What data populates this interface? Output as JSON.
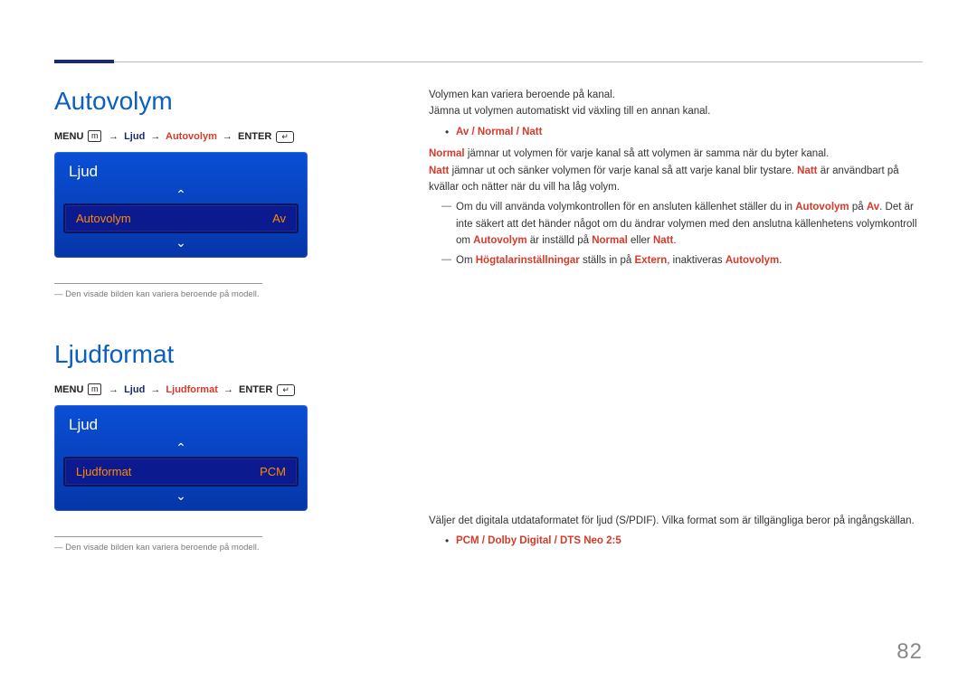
{
  "page_number": "82",
  "section1": {
    "heading": "Autovolym",
    "path": {
      "menu": "MENU",
      "menu_icon": "m",
      "arrow": "→",
      "step1": "Ljud",
      "step2": "Autovolym",
      "enter": "ENTER",
      "enter_icon": "↵"
    },
    "osd": {
      "title": "Ljud",
      "chevron_up": "⌃",
      "chevron_down": "⌄",
      "item_label": "Autovolym",
      "item_value": "Av"
    },
    "img_note": "Den visade bilden kan variera beroende på modell.",
    "body": {
      "p1": "Volymen kan variera beroende på kanal.",
      "p2": "Jämna ut volymen automatiskt vid växling till en annan kanal.",
      "options": "Av / Normal / Natt",
      "normal_lead": "Normal",
      "normal_rest": " jämnar ut volymen för varje kanal så att volymen är samma när du byter kanal.",
      "natt_lead": "Natt",
      "natt_mid": " jämnar ut och sänker volymen för varje kanal så att varje kanal blir tystare. ",
      "natt_lead2": "Natt",
      "natt_rest": " är användbart på kvällar och nätter när du vill ha låg volym.",
      "d1_a": "Om du vill använda volymkontrollen för en ansluten källenhet ställer du in ",
      "d1_av_b": "Autovolym",
      "d1_b": " på ",
      "d1_av_v": "Av",
      "d1_c": ". Det är inte säkert att det händer något om du ändrar volymen med den anslutna källenhetens volymkontroll om ",
      "d1_av_b2": "Autovolym",
      "d1_d": " är inställd på ",
      "d1_norm": "Normal",
      "d1_e": " eller ",
      "d1_natt": "Natt",
      "d1_f": ".",
      "d2_a": "Om ",
      "d2_h": "Högtalarinställningar",
      "d2_b": " ställs in på ",
      "d2_ext": "Extern",
      "d2_c": ", inaktiveras ",
      "d2_av": "Autovolym",
      "d2_d": "."
    }
  },
  "section2": {
    "heading": "Ljudformat",
    "path": {
      "menu": "MENU",
      "menu_icon": "m",
      "arrow": "→",
      "step1": "Ljud",
      "step2": "Ljudformat",
      "enter": "ENTER",
      "enter_icon": "↵"
    },
    "osd": {
      "title": "Ljud",
      "chevron_up": "⌃",
      "chevron_down": "⌄",
      "item_label": "Ljudformat",
      "item_value": "PCM"
    },
    "img_note": "Den visade bilden kan variera beroende på modell.",
    "body": {
      "p1": "Väljer det digitala utdataformatet för ljud (S/PDIF). Vilka format som är tillgängliga beror på ingångskällan.",
      "options": "PCM / Dolby Digital / DTS Neo 2:5"
    }
  }
}
